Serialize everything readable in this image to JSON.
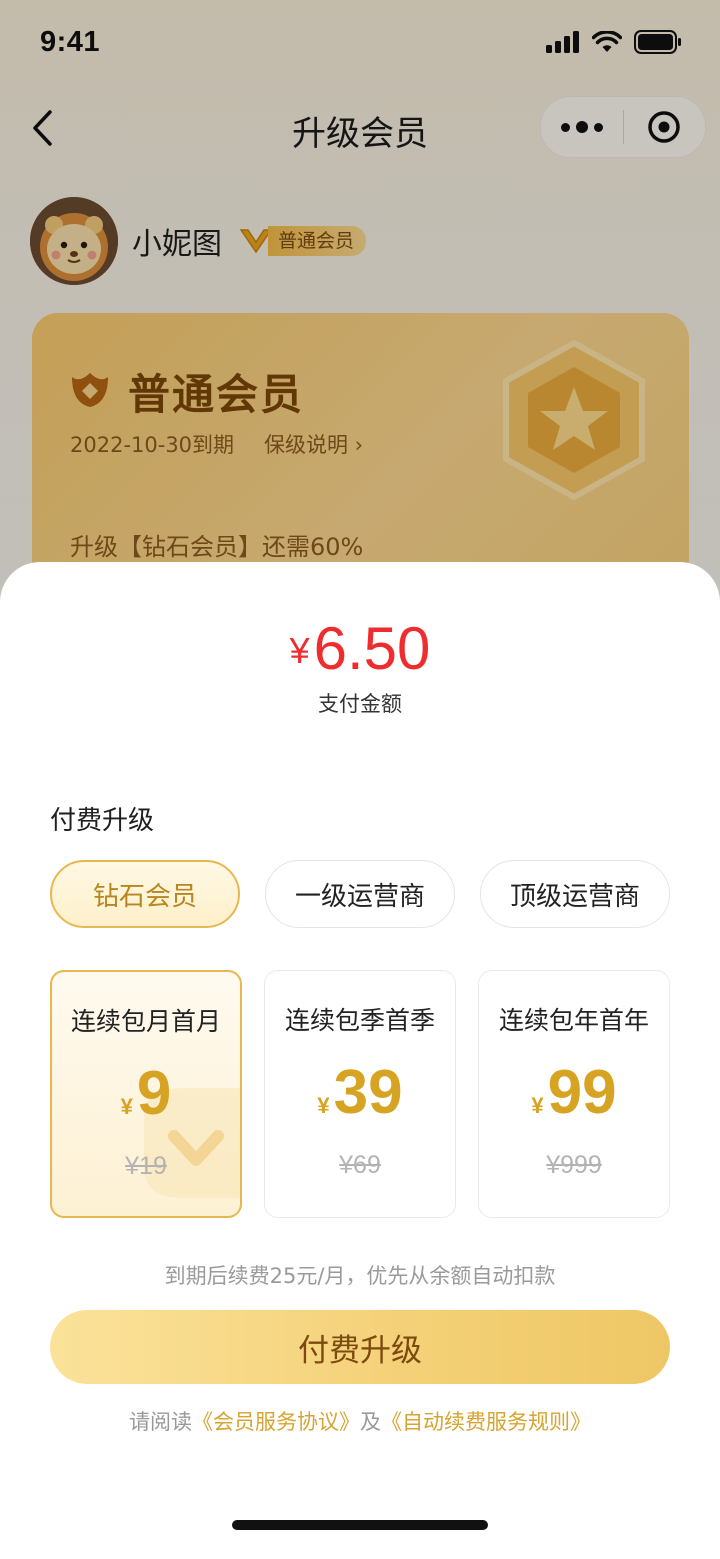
{
  "status_bar": {
    "time": "9:41"
  },
  "nav": {
    "title": "升级会员",
    "back_icon": "chevron-left-icon",
    "more_icon": "more-dots-icon",
    "close_icon": "target-circle-icon"
  },
  "profile": {
    "username": "小妮图",
    "badge": "普通会员"
  },
  "member_card": {
    "title": "普通会员",
    "expire": "2022-10-30到期",
    "link": "保级说明 ›",
    "progress": "升级【钻石会员】还需60%"
  },
  "sheet": {
    "amount_symbol": "¥",
    "amount": "6.50",
    "amount_label": "支付金额",
    "section_title": "付费升级",
    "tiers": [
      {
        "label": "钻石会员",
        "active": true
      },
      {
        "label": "一级运营商",
        "active": false
      },
      {
        "label": "顶级运营商",
        "active": false
      }
    ],
    "plans": [
      {
        "name": "连续包月首月",
        "symbol": "¥",
        "price": "9",
        "original": "¥19",
        "active": true
      },
      {
        "name": "连续包季首季",
        "symbol": "¥",
        "price": "39",
        "original": "¥69",
        "active": false
      },
      {
        "name": "连续包年首年",
        "symbol": "¥",
        "price": "99",
        "original": "¥999",
        "active": false
      }
    ],
    "renew_note": "到期后续费25元/月，优先从余额自动扣款",
    "pay_button": "付费升级",
    "agreement_prefix": "请阅读",
    "agreement_1": "《会员服务协议》",
    "agreement_mid": "及",
    "agreement_2": "《自动续费服务规则》"
  },
  "colors": {
    "accent_gold": "#e7b84f",
    "price_red": "#ef2c2e",
    "price_gold": "#d7a322"
  }
}
